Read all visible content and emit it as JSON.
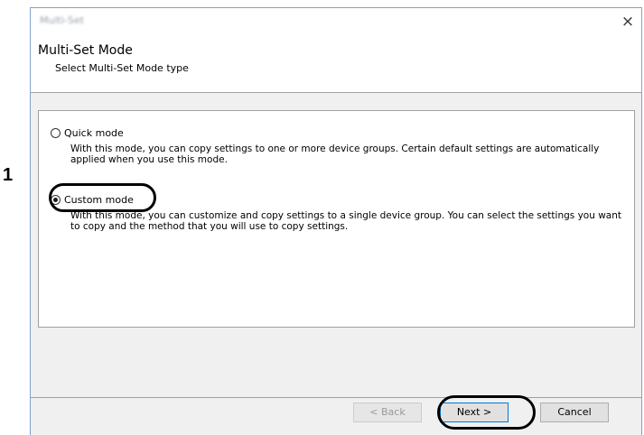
{
  "window": {
    "title": "Multi-Set",
    "close_glyph": "×"
  },
  "header": {
    "title": "Multi-Set Mode",
    "subtitle": "Select Multi-Set Mode type"
  },
  "options": [
    {
      "label": "Quick mode",
      "selected": false,
      "description": "With this mode, you can copy settings to one or more device groups. Certain default settings are automatically applied when you use this mode."
    },
    {
      "label": "Custom mode",
      "selected": true,
      "description": "With this mode, you can customize and copy settings to a single device group. You can select the settings you want to copy and the method that you will use to copy settings."
    }
  ],
  "annotation": {
    "step_number": "1"
  },
  "buttons": {
    "back": "< Back",
    "next": "Next >",
    "cancel": "Cancel"
  },
  "icons": {
    "close": "close-icon",
    "radio": "radio-icon"
  },
  "colors": {
    "accent": "#0078d7",
    "window_border": "#7fa2c8",
    "dialog_bg": "#f0f0f0"
  }
}
